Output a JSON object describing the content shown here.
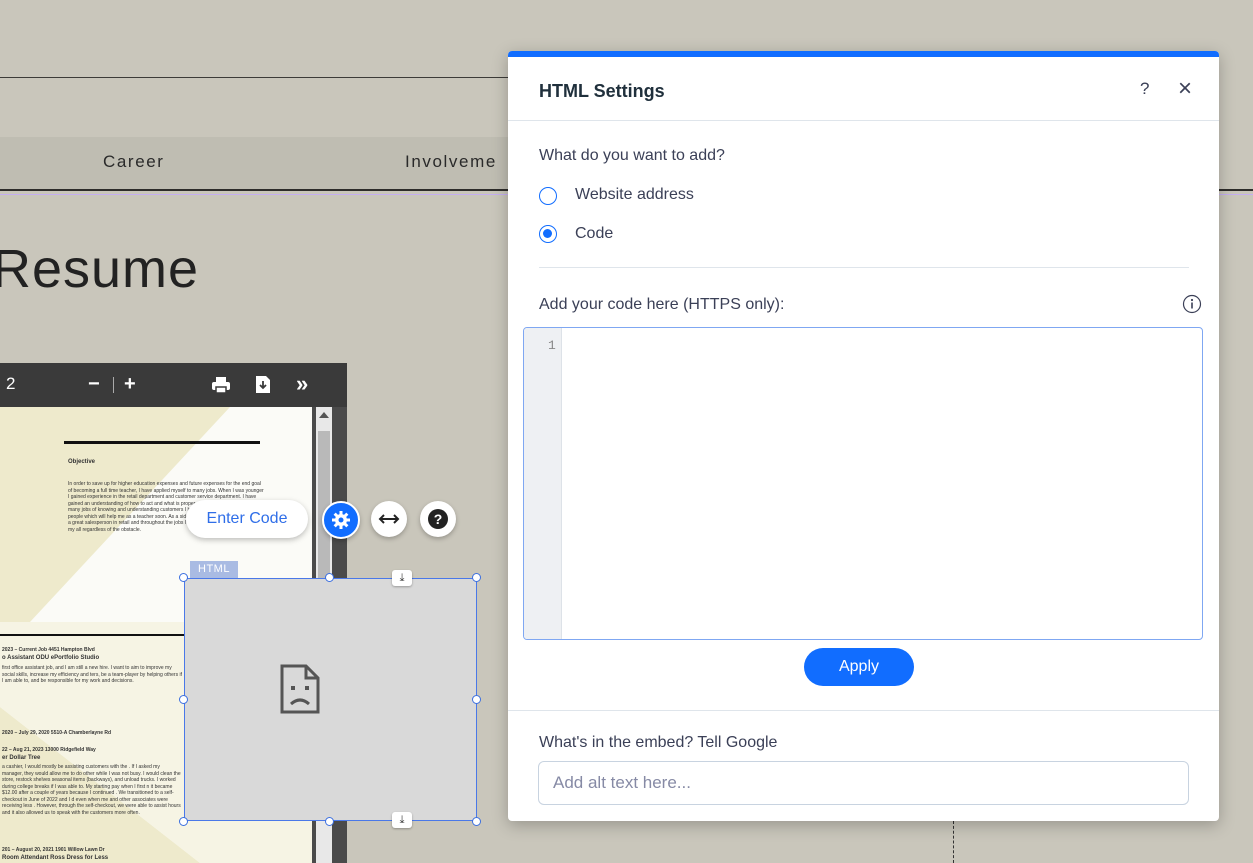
{
  "site": {
    "nav_items": [
      "Career",
      "Involveme"
    ],
    "resume_title": "Resume"
  },
  "pdf_viewer": {
    "page_fragment": "2",
    "zoom_out": "−",
    "zoom_in": "+",
    "more": "»",
    "objective_heading": "Objective",
    "objective_text": "In order to save up for higher education expenses and future expenses for the end goal of becoming a full time teacher, I have applied myself to many jobs. When I was younger I gained experience in the retail department and customer service department. I have gained an understanding of how to act and what is proper customer service. Through many jobs of knowing and understanding customers I have learned to understand people which will help me as a teacher soon. As a side result, I know what it takes to be a great salesperson in retail and throughout the jobs I was a part of I have always given my all regardless of the obstacle.",
    "job1_line1": "2023 – Current Job   4451 Hampton Blvd",
    "job1_line2": "o Assistant ODU ePortfolio Studio",
    "job1_text": "first office assistant job, and I am still a new hire. I want to aim to improve my social skills, increase my efficiency and ters, be a team-player by helping others if I am able to, and be responsible for my work and decisions.",
    "job2_line1": "2020 – July 29, 2020   5510-A Chamberlayne Rd",
    "job3_line1": "22 – Aug 21, 2023   13000 Ridgefield Way",
    "job3_line2": "er Dollar Tree",
    "job3_text": "a cashier, I would mostly be assisting customers with the . If I asked my manager, they would allow me to do other while I was not busy. I would clean the store, restock shelves seasonal items (backways), and unload trucks. I worked during college breaks if I was able to. My starting pay when I first n it became $12.00 after a couple of years because I continued . We transitioned to a self-checkout in June of 2022 and I d even when me and other associates were receiving less . However, through the self-checkout, we were able to assist hours and it also allowed us to speak with the customers more often.",
    "job4_line1": "201 – August 20, 2021   1901 Willow Lawn Dr",
    "job4_line2": "Room Attendant Ross Dress for Less"
  },
  "editor_overlay": {
    "enter_code_label": "Enter Code",
    "html_tag_label": "HTML",
    "settings_icon": "gear-icon",
    "stretch_icon": "horizontal-arrows-icon",
    "help_icon": "question-icon",
    "broken_embed_icon": "broken-document-icon"
  },
  "dialog": {
    "title": "HTML Settings",
    "help_label": "?",
    "close_label": "×",
    "question": "What do you want to add?",
    "options": [
      {
        "label": "Website address",
        "selected": false
      },
      {
        "label": "Code",
        "selected": true
      }
    ],
    "code_label": "Add your code here (HTTPS only):",
    "info_icon": "info-icon",
    "line_number": "1",
    "code_value": "",
    "apply_label": "Apply",
    "alt_label": "What's in the embed? Tell Google",
    "alt_placeholder": "Add alt text here...",
    "accent_color": "#116dff"
  }
}
